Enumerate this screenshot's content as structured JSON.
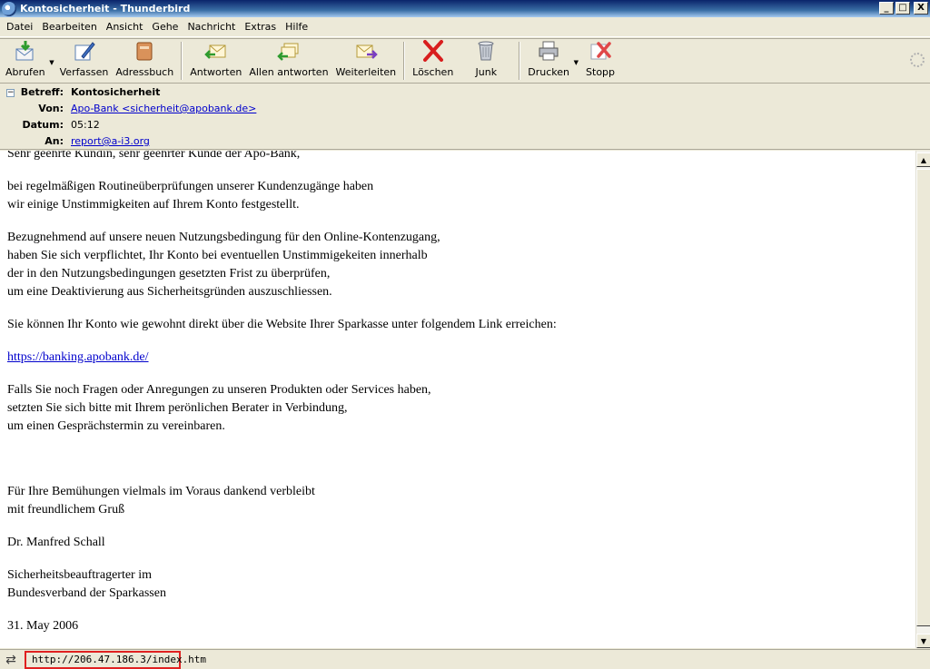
{
  "window": {
    "title": "Kontosicherheit - Thunderbird",
    "controls": [
      "_",
      "□",
      "X"
    ]
  },
  "menu": [
    {
      "label": "Datei"
    },
    {
      "label": "Bearbeiten"
    },
    {
      "label": "Ansicht"
    },
    {
      "label": "Gehe"
    },
    {
      "label": "Nachricht"
    },
    {
      "label": "Extras"
    },
    {
      "label": "Hilfe"
    }
  ],
  "toolbar": {
    "abrufen": "Abrufen",
    "verfassen": "Verfassen",
    "adressbuch": "Adressbuch",
    "antworten": "Antworten",
    "allen_antworten": "Allen antworten",
    "weiterleiten": "Weiterleiten",
    "loeschen": "Löschen",
    "junk": "Junk",
    "drucken": "Drucken",
    "stopp": "Stopp"
  },
  "header": {
    "subject_label": "Betreff:",
    "subject": "Kontosicherheit",
    "from_label": "Von:",
    "from": "Apo-Bank <sicherheit@apobank.de>",
    "date_label": "Datum:",
    "date": "05:12",
    "to_label": "An:",
    "to": "report@a-i3.org"
  },
  "body": {
    "greeting": "Sehr geehrte Kundin, sehr geehrter Kunde der Apo-Bank,",
    "p1": [
      "bei regelmäßigen Routineüberprüfungen unserer Kundenzugänge haben",
      "wir einige Unstimmigkeiten auf Ihrem Konto festgestellt."
    ],
    "p2": [
      "Bezugnehmend auf unsere neuen Nutzungsbedingung für den Online-Kontenzugang,",
      "haben Sie sich verpflichtet, Ihr Konto bei eventuellen Unstimmigekeiten innerhalb",
      "der in den Nutzungsbedingungen gesetzten Frist zu überprüfen,",
      "um eine Deaktivierung aus Sicherheitsgründen auszuschliessen."
    ],
    "p3": "Sie können Ihr Konto wie gewohnt direkt über die Website Ihrer Sparkasse unter folgendem Link erreichen:",
    "link": "https://banking.apobank.de/",
    "p4": [
      "Falls Sie noch Fragen oder Anregungen zu unseren Produkten oder Services haben,",
      "setzten Sie sich bitte mit Ihrem perönlichen Berater in Verbindung,",
      "um einen Gesprächstermin zu vereinbaren."
    ],
    "p5": [
      "Für Ihre Bemühungen vielmals im Voraus dankend verbleibt",
      "mit freundlichem Gruß"
    ],
    "signature": "Dr. Manfred Schall",
    "p6": [
      "Sicherheitsbeauftragerter im",
      "Bundesverband der Sparkassen"
    ],
    "date": "31. May 2006"
  },
  "status": {
    "url": "http://206.47.186.3/index.htm"
  }
}
